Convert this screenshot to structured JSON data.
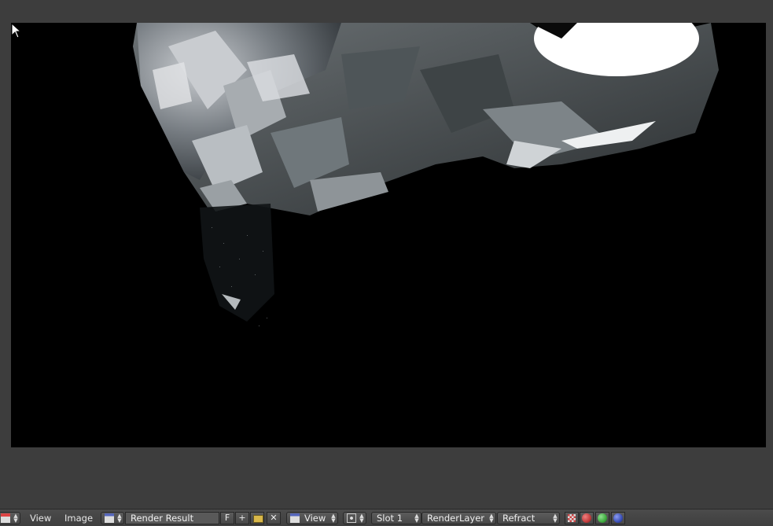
{
  "menus": {
    "view": "View",
    "image": "Image"
  },
  "image_name": "Render Result",
  "fake_user": "F",
  "view_dropdown": "View",
  "slot": "Slot 1",
  "render_layer": "RenderLayer",
  "render_pass": "Refract",
  "icons": {
    "editor_type": "image-editor-icon",
    "browse": "image-browse-icon",
    "new": "plus-icon",
    "open": "folder-icon",
    "unlink": "close-icon",
    "pivot": "snap-pivot-icon",
    "alpha": "checker-alpha-icon",
    "red": "red-channel-icon",
    "green": "green-channel-icon",
    "blue": "blue-channel-icon"
  },
  "colors": {
    "red": "#c23b3b",
    "green": "#3faa3f",
    "blue": "#3a4fb8"
  }
}
